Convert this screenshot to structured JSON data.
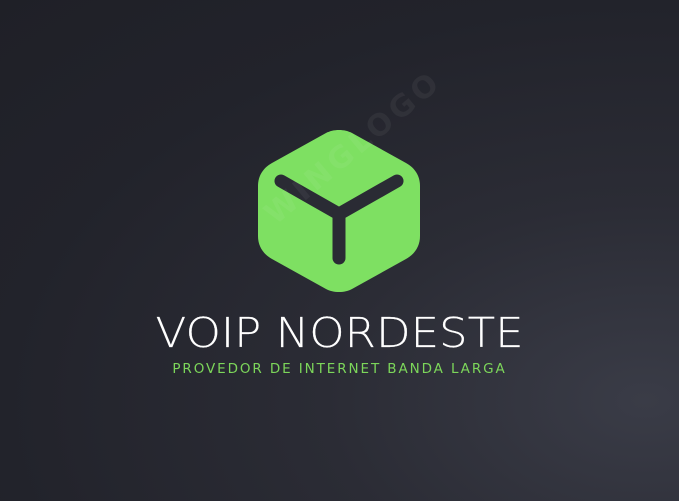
{
  "brand": {
    "name": "VOIP NORDESTE",
    "tagline": "PROVEDOR DE INTERNET BANDA LARGA",
    "watermark": "WINGLOGO"
  },
  "colors": {
    "background": "#25262e",
    "accent": "#7ee062",
    "text": "#ffffff",
    "tagline": "#7cd65a"
  },
  "icons": {
    "logo": "hexagon-cube-icon"
  }
}
